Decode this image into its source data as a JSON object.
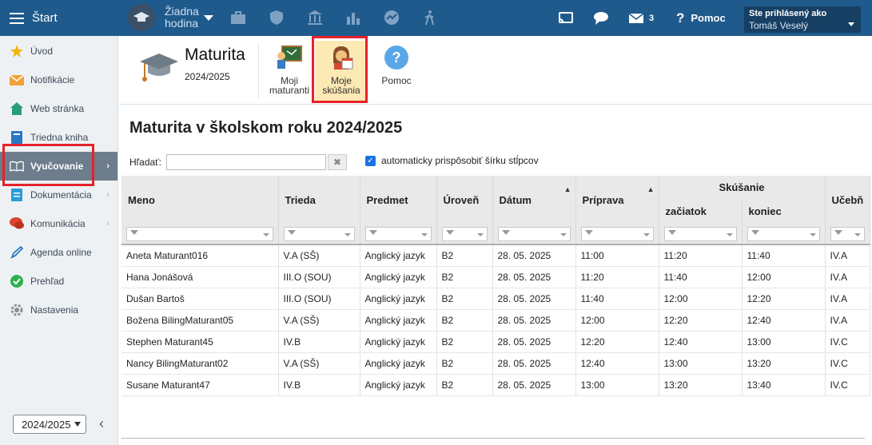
{
  "topbar": {
    "start_label": "Štart",
    "hour_line1": "Žiadna",
    "hour_line2": "hodina",
    "messages_count": "3",
    "help_label": "Pomoc",
    "login_line1": "Ste prihlásený ako",
    "login_user": "Tomáš Veselý"
  },
  "sidebar": {
    "items": [
      {
        "label": "Úvod",
        "icon": "star-icon"
      },
      {
        "label": "Notifikácie",
        "icon": "envelope-icon"
      },
      {
        "label": "Web stránka",
        "icon": "house-icon"
      },
      {
        "label": "Triedna kniha",
        "icon": "book-icon"
      },
      {
        "label": "Vyučovanie",
        "icon": "open-book-icon"
      },
      {
        "label": "Dokumentácia",
        "icon": "document-icon"
      },
      {
        "label": "Komunikácia",
        "icon": "chat-icon"
      },
      {
        "label": "Agenda online",
        "icon": "pen-icon"
      },
      {
        "label": "Prehľad",
        "icon": "check-icon"
      },
      {
        "label": "Nastavenia",
        "icon": "gear-icon"
      }
    ],
    "year": "2024/2025"
  },
  "toolbar": {
    "title": "Maturita",
    "subtitle": "2024/2025",
    "btn_graduates_line1": "Moji",
    "btn_graduates_line2": "maturanti",
    "btn_exams_line1": "Moje",
    "btn_exams_line2": "skúšania",
    "btn_help": "Pomoc"
  },
  "content": {
    "heading": "Maturita v školskom roku 2024/2025",
    "search_label": "Hľadať:",
    "search_value": "",
    "auto_width_label": "automaticky prispôsobiť šírku stĺpcov"
  },
  "table": {
    "columns": {
      "name": "Meno",
      "class": "Trieda",
      "subject": "Predmet",
      "level": "Úroveň",
      "date": "Dátum",
      "prep": "Príprava",
      "exam_group": "Skúšanie",
      "exam_start": "začiatok",
      "exam_end": "koniec",
      "room": "Učebň"
    },
    "rows": [
      [
        "Aneta Maturant016",
        "V.A (SŠ)",
        "Anglický jazyk",
        "B2",
        "28. 05. 2025",
        "11:00",
        "11:20",
        "11:40",
        "IV.A"
      ],
      [
        "Hana Jonášová",
        "III.O (SOU)",
        "Anglický jazyk",
        "B2",
        "28. 05. 2025",
        "11:20",
        "11:40",
        "12:00",
        "IV.A"
      ],
      [
        "Dušan Bartoš",
        "III.O (SOU)",
        "Anglický jazyk",
        "B2",
        "28. 05. 2025",
        "11:40",
        "12:00",
        "12:20",
        "IV.A"
      ],
      [
        "Božena BilingMaturant05",
        "V.A (SŠ)",
        "Anglický jazyk",
        "B2",
        "28. 05. 2025",
        "12:00",
        "12:20",
        "12:40",
        "IV.A"
      ],
      [
        "Stephen Maturant45",
        "IV.B",
        "Anglický jazyk",
        "B2",
        "28. 05. 2025",
        "12:20",
        "12:40",
        "13:00",
        "IV.C"
      ],
      [
        "Nancy BilingMaturant02",
        "V.A (SŠ)",
        "Anglický jazyk",
        "B2",
        "28. 05. 2025",
        "12:40",
        "13:00",
        "13:20",
        "IV.C"
      ],
      [
        "Susane Maturant47",
        "IV.B",
        "Anglický jazyk",
        "B2",
        "28. 05. 2025",
        "13:00",
        "13:20",
        "13:40",
        "IV.C"
      ]
    ]
  },
  "colors": {
    "topbar": "#1f5a8c",
    "sidebar_active": "#6d7d8c",
    "highlight": "#e5222a",
    "selected_button": "#fde9b4"
  }
}
